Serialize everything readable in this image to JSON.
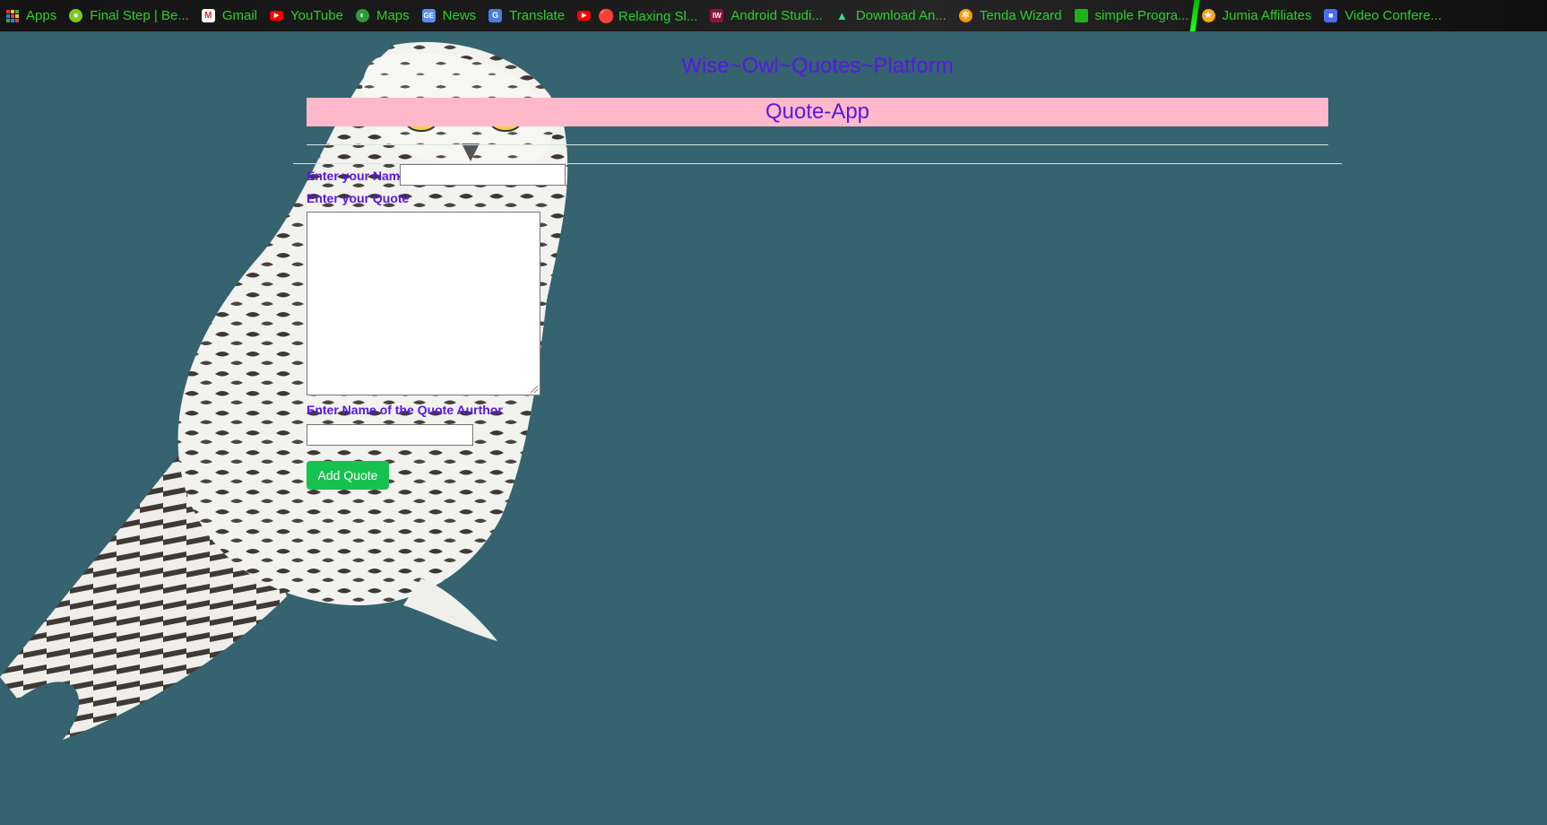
{
  "bookmarks_bar": {
    "items": [
      {
        "label": "Apps",
        "icon": "apps-grid-icon"
      },
      {
        "label": "Final Step | Be...",
        "icon": "person-green-icon"
      },
      {
        "label": "Gmail",
        "icon": "gmail-icon"
      },
      {
        "label": "YouTube",
        "icon": "youtube-icon"
      },
      {
        "label": "Maps",
        "icon": "maps-globe-icon"
      },
      {
        "label": "News",
        "icon": "google-news-icon"
      },
      {
        "label": "Translate",
        "icon": "google-translate-icon"
      },
      {
        "label": "🔴 Relaxing Sl...",
        "icon": "youtube-icon"
      },
      {
        "label": "Android Studi...",
        "icon": "iw-icon"
      },
      {
        "label": "Download An...",
        "icon": "android-icon"
      },
      {
        "label": "Tenda Wizard",
        "icon": "tenda-gear-icon"
      },
      {
        "label": "simple Progra...",
        "icon": "folder-icon"
      },
      {
        "label": "Jumia Affiliates",
        "icon": "jumia-star-icon"
      },
      {
        "label": "Video Confere...",
        "icon": "video-camera-icon"
      }
    ]
  },
  "page": {
    "site_title": "Wise~Owl~Quotes~Platform",
    "app_title": "Quote-App"
  },
  "form": {
    "name_label": "Enter your Name",
    "name_value": "",
    "quote_label": "Enter your Quote",
    "quote_value": "",
    "author_label": "Enter Name of the Quote Aurthor",
    "author_value": "",
    "submit_label": "Add Quote"
  },
  "colors": {
    "background": "#35636f",
    "heading": "#5a17e6",
    "app_bar": "#ffb9ca",
    "button": "#17c14f",
    "bookmark_text": "#2bd12b"
  }
}
